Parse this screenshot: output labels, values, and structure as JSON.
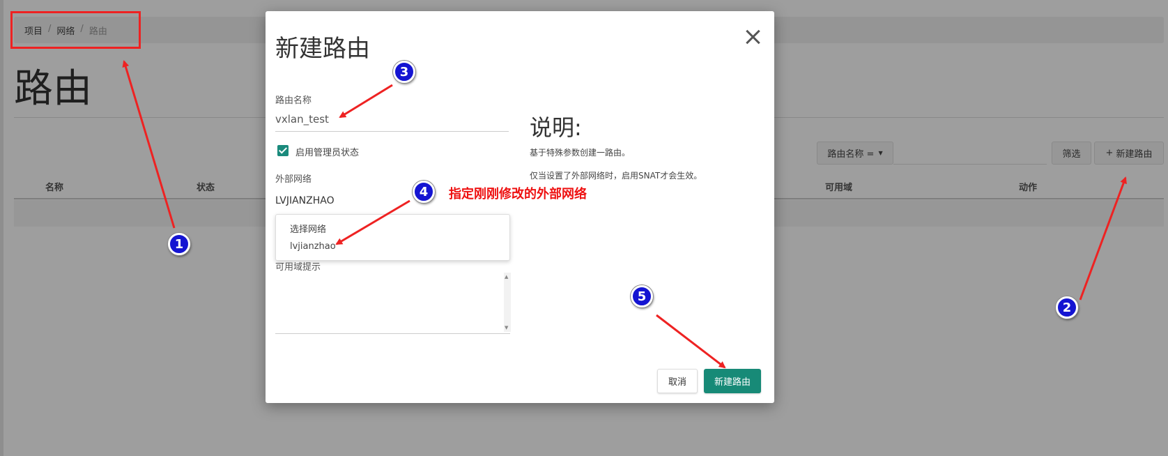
{
  "breadcrumb": {
    "items": [
      "项目",
      "网络"
    ],
    "current": "路由"
  },
  "page": {
    "title": "路由"
  },
  "toolbar": {
    "filter_select_label": "路由名称 =",
    "filter_button": "筛选",
    "create_button": "新建路由",
    "create_plus": "+"
  },
  "table": {
    "columns": [
      "名称",
      "状态",
      "可用域",
      "动作"
    ]
  },
  "modal": {
    "title": "新建路由",
    "name_label": "路由名称",
    "name_value": "vxlan_test",
    "admin_state_label": "启用管理员状态",
    "admin_state_checked": true,
    "ext_network_label": "外部网络",
    "ext_network_value": "LVJIANZHAO",
    "dropdown_options": [
      "选择网络",
      "lvjianzhao"
    ],
    "az_hint_label": "可用域提示",
    "description_title": "说明:",
    "description_lines": [
      "基于特殊参数创建一路由。",
      "仅当设置了外部网络时，启用SNAT才会生效。"
    ],
    "cancel_button": "取消",
    "submit_button": "新建路由"
  },
  "annotations": {
    "markers": [
      "1",
      "2",
      "3",
      "4",
      "5"
    ],
    "note_4": "指定刚刚修改的外部网络",
    "color_red": "#ee2222",
    "color_marker": "#1414d2"
  },
  "colors": {
    "accent": "#178a77"
  }
}
